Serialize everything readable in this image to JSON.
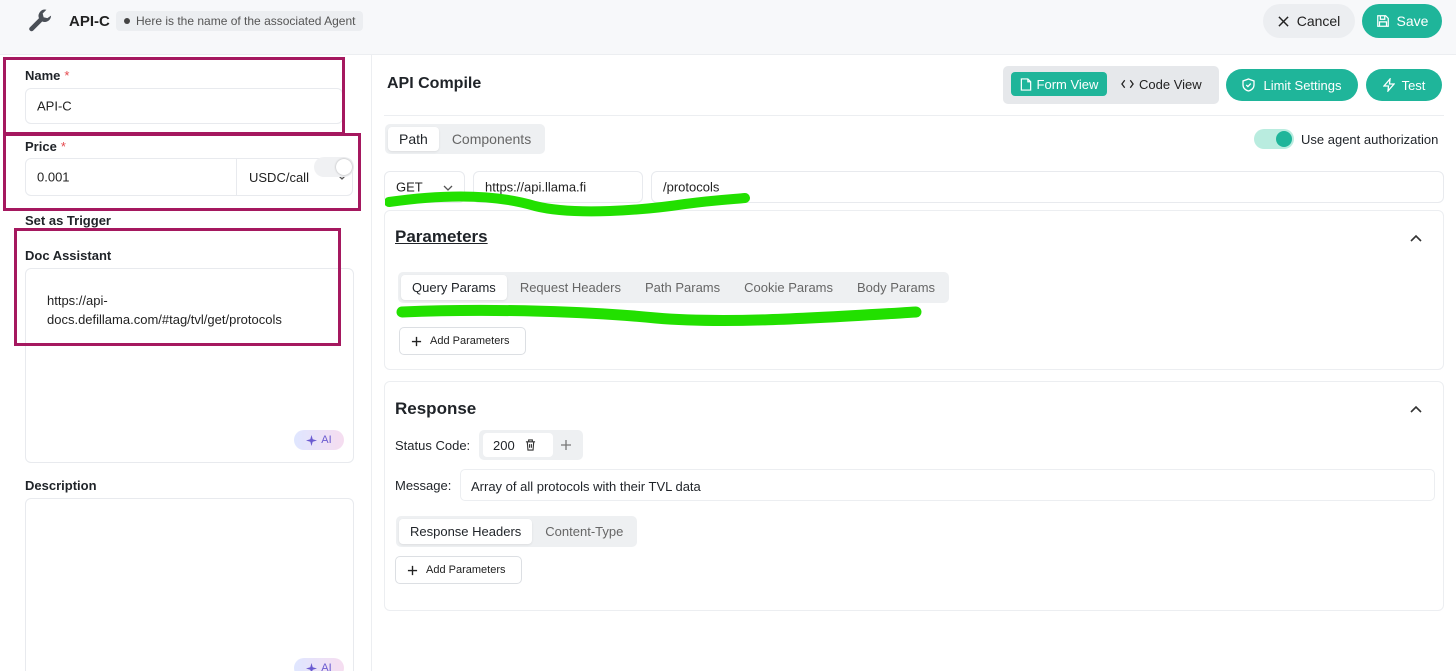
{
  "header": {
    "title": "API-C",
    "agent_hint": "Here is the name of the associated Agent",
    "cancel_label": "Cancel",
    "save_label": "Save"
  },
  "form": {
    "name_label": "Name",
    "name_value": "API-C",
    "price_label": "Price",
    "price_value": "0.001",
    "price_unit": "USDC/call",
    "required_mark": "*",
    "trigger_label": "Set as Trigger",
    "doc_label": "Doc Assistant",
    "doc_value": "https://api-docs.defillama.com/#tag/tvl/get/protocols",
    "ai_label": "AI",
    "description_label": "Description"
  },
  "compile": {
    "title": "API Compile",
    "form_view_label": "Form View",
    "code_view_label": "Code View",
    "limit_label": "Limit Settings",
    "test_label": "Test",
    "tabs": [
      "Path",
      "Components"
    ],
    "auth_label": "Use agent authorization",
    "method": "GET",
    "base_url": "https://api.llama.fi",
    "path": "/protocols"
  },
  "parameters": {
    "title": "Parameters",
    "tabs": [
      "Query Params",
      "Request Headers",
      "Path Params",
      "Cookie Params",
      "Body Params"
    ],
    "add_label": "Add Parameters"
  },
  "response": {
    "title": "Response",
    "status_label": "Status Code:",
    "status_code": "200",
    "message_label": "Message:",
    "message_value": "Array of all protocols with their TVL data",
    "tabs": [
      "Response Headers",
      "Content-Type"
    ],
    "add_label": "Add Parameters"
  },
  "colors": {
    "accent": "#1fb59a",
    "highlight_box": "#a5185f",
    "highlight_scribble": "#22e000"
  }
}
